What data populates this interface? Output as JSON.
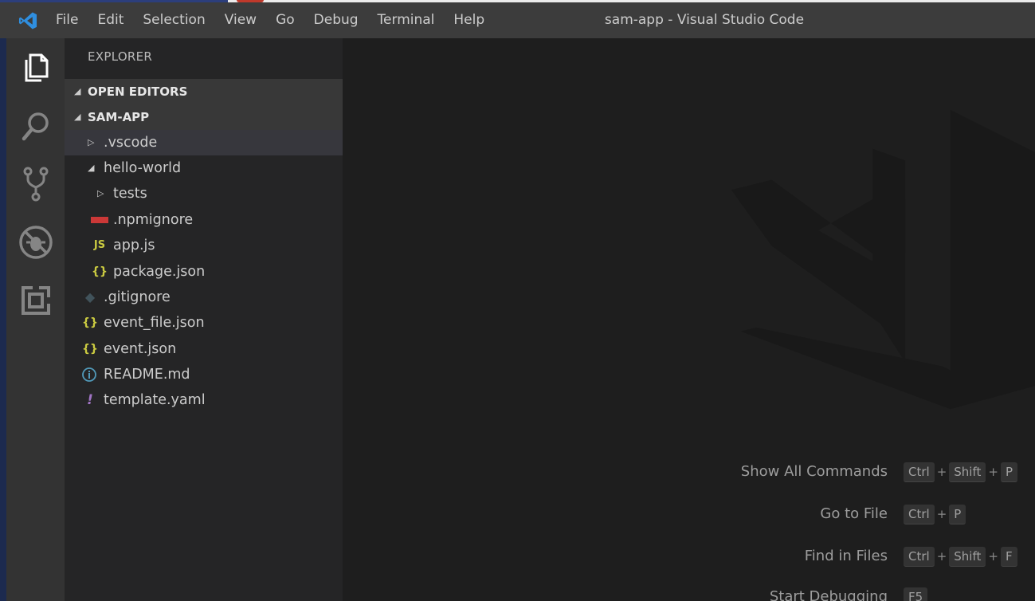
{
  "window": {
    "title": "sam-app - Visual Studio Code"
  },
  "menu": [
    "File",
    "Edit",
    "Selection",
    "View",
    "Go",
    "Debug",
    "Terminal",
    "Help"
  ],
  "activity_bar": {
    "icons": [
      "files-icon",
      "search-icon",
      "source-control-icon",
      "debug-icon",
      "extensions-icon"
    ]
  },
  "sidebar": {
    "title": "EXPLORER",
    "open_editors": "OPEN EDITORS",
    "project": "SAM-APP",
    "tree": [
      {
        "name": ".vscode",
        "kind": "folder",
        "expanded": false
      },
      {
        "name": "hello-world",
        "kind": "folder",
        "expanded": true
      },
      {
        "name": "tests",
        "kind": "folder",
        "expanded": false
      },
      {
        "name": ".npmignore",
        "kind": "file",
        "icon": "npm-icon"
      },
      {
        "name": "app.js",
        "kind": "file",
        "icon": "js-icon",
        "icon_text": "JS"
      },
      {
        "name": "package.json",
        "kind": "file",
        "icon": "json-icon",
        "icon_text": "{}"
      },
      {
        "name": ".gitignore",
        "kind": "file",
        "icon": "git-icon"
      },
      {
        "name": "event_file.json",
        "kind": "file",
        "icon": "json-icon",
        "icon_text": "{}"
      },
      {
        "name": "event.json",
        "kind": "file",
        "icon": "json-icon",
        "icon_text": "{}"
      },
      {
        "name": "README.md",
        "kind": "file",
        "icon": "info-icon"
      },
      {
        "name": "template.yaml",
        "kind": "file",
        "icon": "yaml-icon",
        "icon_text": "!"
      }
    ]
  },
  "shortcuts": [
    {
      "label": "Show All Commands",
      "keys": [
        "Ctrl",
        "Shift",
        "P"
      ]
    },
    {
      "label": "Go to File",
      "keys": [
        "Ctrl",
        "P"
      ]
    },
    {
      "label": "Find in Files",
      "keys": [
        "Ctrl",
        "Shift",
        "F"
      ]
    },
    {
      "label": "Start Debugging",
      "keys": [
        "F5"
      ]
    }
  ],
  "colors": {
    "accent_blue": "#0078d4",
    "json_yellow": "#cbcb41",
    "yaml_purple": "#a074c4",
    "info_blue": "#519aba",
    "npm_red": "#cb3837",
    "git_gray": "#41535b"
  }
}
